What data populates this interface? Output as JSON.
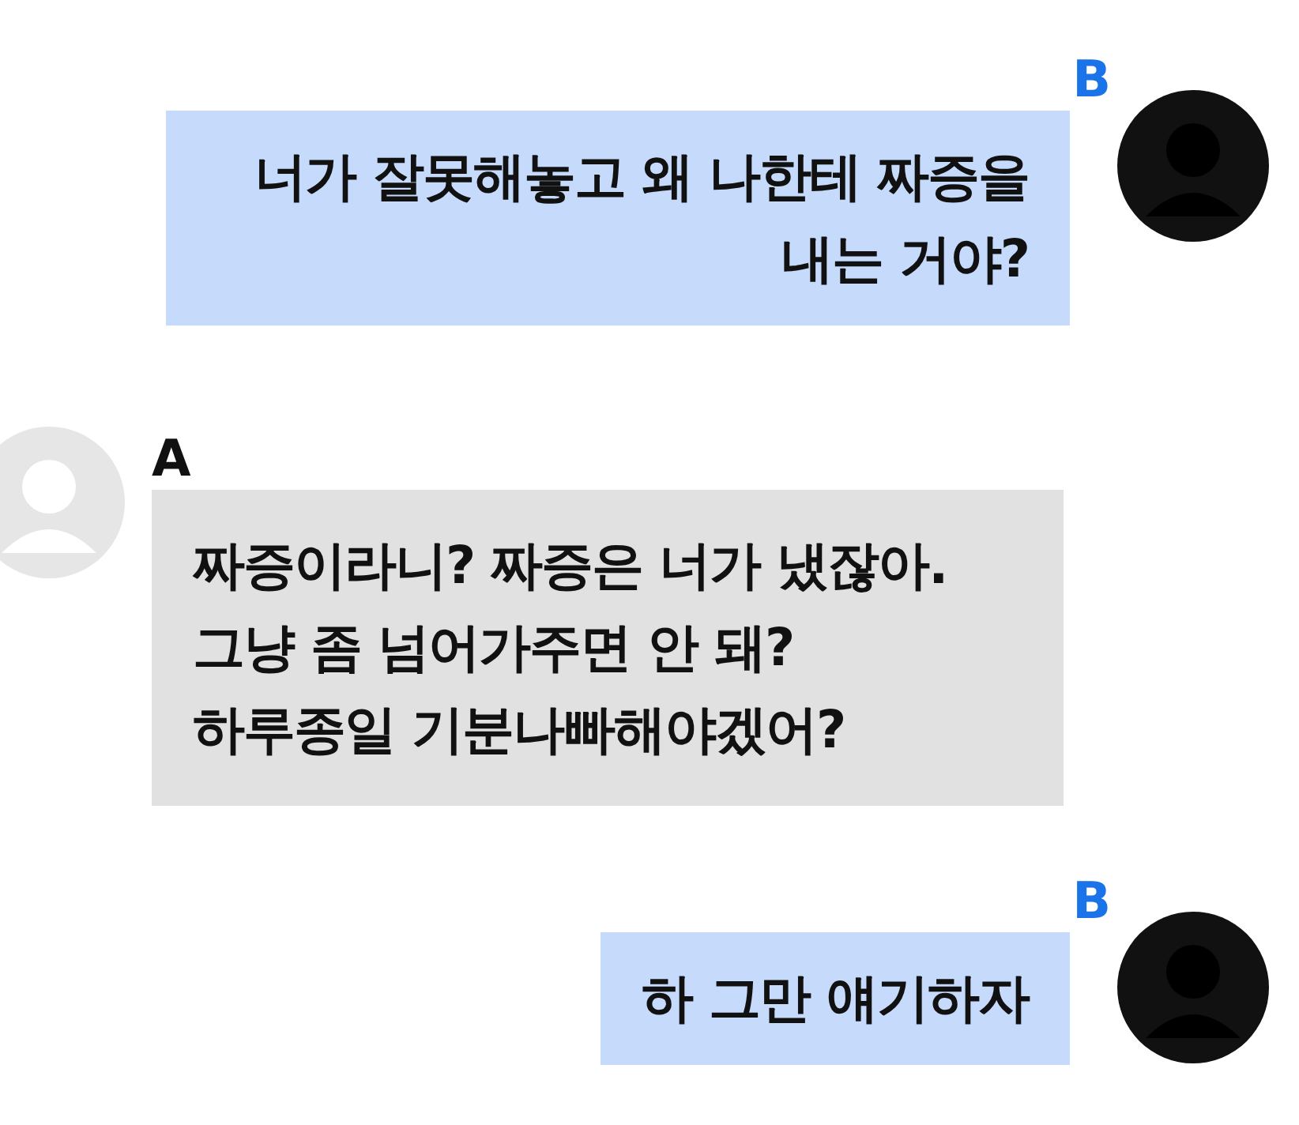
{
  "messages": [
    {
      "sender": "B",
      "kind": "outgoing",
      "lines": [
        "너가 잘못해놓고 왜 나한테 짜증을",
        "내는 거야?"
      ]
    },
    {
      "sender": "A",
      "kind": "incoming",
      "lines": [
        "짜증이라니? 짜증은 너가 냈잖아.",
        "그냥 좀 넘어가주면 안 돼?",
        "하루종일 기분나빠해야겠어?"
      ]
    },
    {
      "sender": "B",
      "kind": "outgoing",
      "lines": [
        "하 그만 얘기하자"
      ]
    }
  ]
}
